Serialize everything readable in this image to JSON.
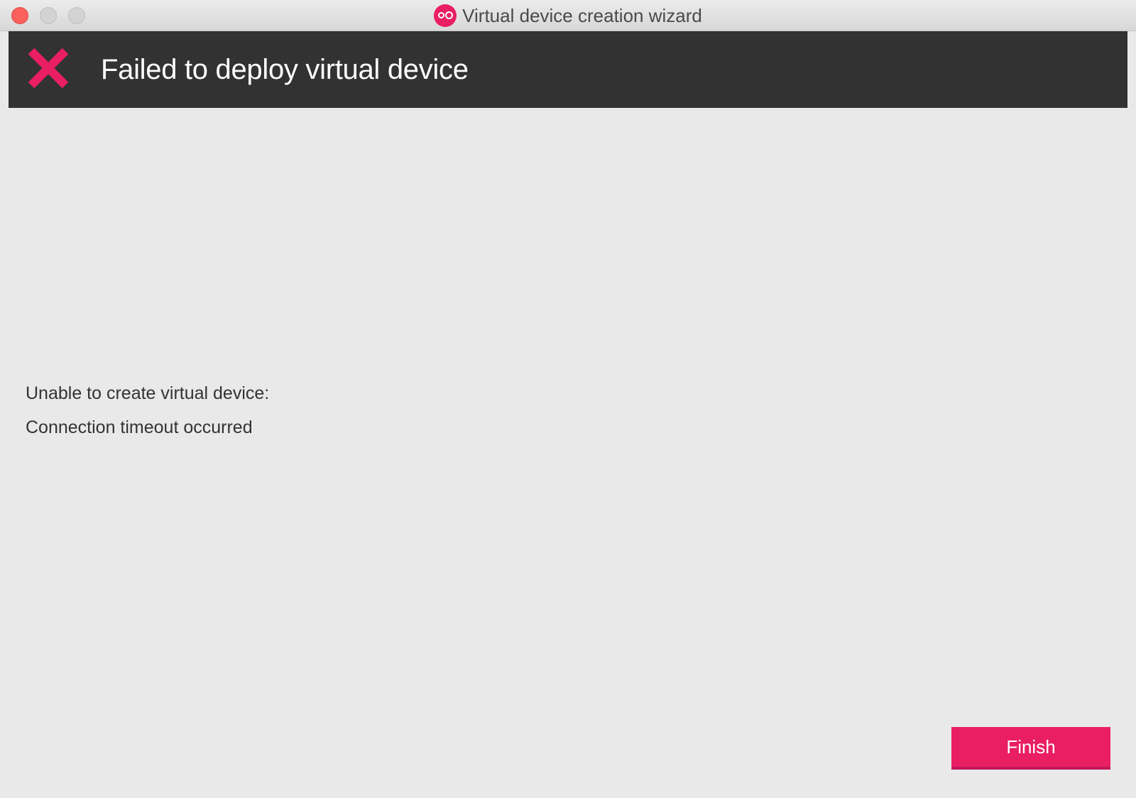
{
  "window": {
    "title": "Virtual device creation wizard"
  },
  "banner": {
    "heading": "Failed to deploy virtual device"
  },
  "body": {
    "line1": "Unable to create virtual device:",
    "line2": "Connection timeout occurred"
  },
  "actions": {
    "finish_label": "Finish"
  },
  "colors": {
    "accent": "#e91e63",
    "banner_bg": "#323232",
    "window_bg": "#e9e9e9"
  },
  "icons": {
    "app": "genymotion-logo-icon",
    "status": "error-x-icon"
  }
}
